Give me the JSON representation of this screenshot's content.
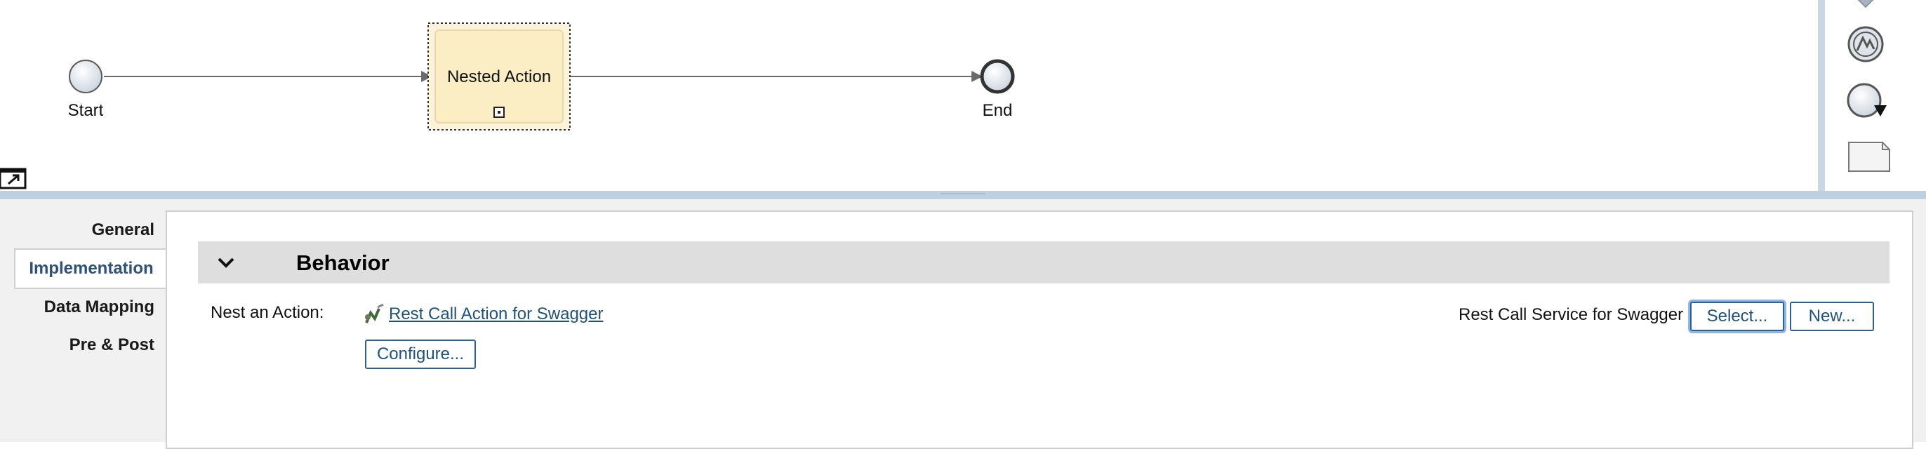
{
  "diagram": {
    "start_label": "Start",
    "task_label": "Nested Action",
    "end_label": "End"
  },
  "palette": {
    "items": [
      "diamond-icon",
      "signal-event-icon",
      "event-dropdown-icon",
      "note-icon"
    ]
  },
  "tabs": [
    {
      "label": "General"
    },
    {
      "label": "Implementation"
    },
    {
      "label": "Data Mapping"
    },
    {
      "label": "Pre & Post"
    }
  ],
  "section": {
    "title": "Behavior"
  },
  "form": {
    "nest_label": "Nest an Action:",
    "action_link": "Rest Call Action for Swagger",
    "service_label": "Rest Call Service for Swagger",
    "configure_button": "Configure...",
    "select_button": "Select...",
    "new_button": "New..."
  },
  "colors": {
    "link": "#20527a",
    "splitter": "#bdd0df",
    "task_fill": "#fbedc4",
    "active_tab_text": "#2e5176"
  }
}
